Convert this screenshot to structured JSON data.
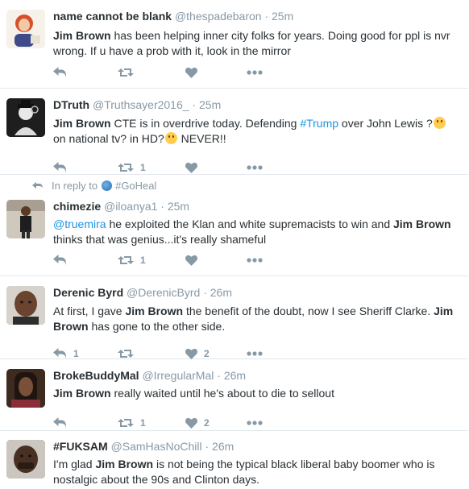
{
  "icons": {
    "reply": "reply-icon",
    "retweet": "retweet-icon",
    "like": "heart-icon",
    "more": "more-icon",
    "thinking": "thinking-face-emoji"
  },
  "colors": {
    "link": "#1b95e0",
    "muted": "#8899a6",
    "text": "#292f33"
  },
  "tweets": [
    {
      "name": "name cannot be blank",
      "handle": "@thespadebaron",
      "dot": "·",
      "time": "25m",
      "text": {
        "p1": "Jim Brown",
        "p2": " has been helping inner city folks for years. Doing good for ppl is nvr wrong. If u have a prob with it, look in the mirror"
      },
      "retweets": "",
      "likes": "",
      "replies": ""
    },
    {
      "name": "DTruth",
      "handle": "@Truthsayer2016_",
      "dot": "·",
      "time": "25m",
      "text": {
        "p1": "Jim Brown",
        "p2": " CTE is in overdrive today. Defending ",
        "p3": "#Trump",
        "p4": " over John Lewis ?",
        "p5": " on national tv? in HD?",
        "p6": " NEVER!!"
      },
      "retweets": "1",
      "likes": "",
      "replies": ""
    },
    {
      "reply_context": {
        "prefix": "In reply to",
        "target": "#GoHeal"
      },
      "name": "chimezie",
      "handle": "@iloanya1",
      "dot": "·",
      "time": "25m",
      "text": {
        "p1": "@truemira",
        "p2": " he exploited the Klan and white supremacists to win and ",
        "p3": "Jim Brown",
        "p4": " thinks that was genius...it's really shameful"
      },
      "retweets": "1",
      "likes": "",
      "replies": ""
    },
    {
      "name": "Derenic Byrd",
      "handle": "@DerenicByrd",
      "dot": "·",
      "time": "26m",
      "text": {
        "p1": "At first, I gave ",
        "p2": "Jim Brown",
        "p3": " the benefit of the doubt, now I see Sheriff Clarke. ",
        "p4": "Jim Brown",
        "p5": " has gone to the other side."
      },
      "replies": "1",
      "retweets": "",
      "likes": "2"
    },
    {
      "name": "BrokeBuddyMal",
      "handle": "@IrregularMal",
      "dot": "·",
      "time": "26m",
      "text": {
        "p1": "Jim Brown",
        "p2": " really waited until he's about to die to sellout"
      },
      "replies": "",
      "retweets": "1",
      "likes": "2"
    },
    {
      "name": "#FUKSAM",
      "handle": "@SamHasNoChill",
      "dot": "·",
      "time": "26m",
      "text": {
        "p1": "I'm glad ",
        "p2": "Jim Brown",
        "p3": " is not being the typical black liberal baby boomer who is nostalgic about the 90s and Clinton days."
      }
    }
  ]
}
